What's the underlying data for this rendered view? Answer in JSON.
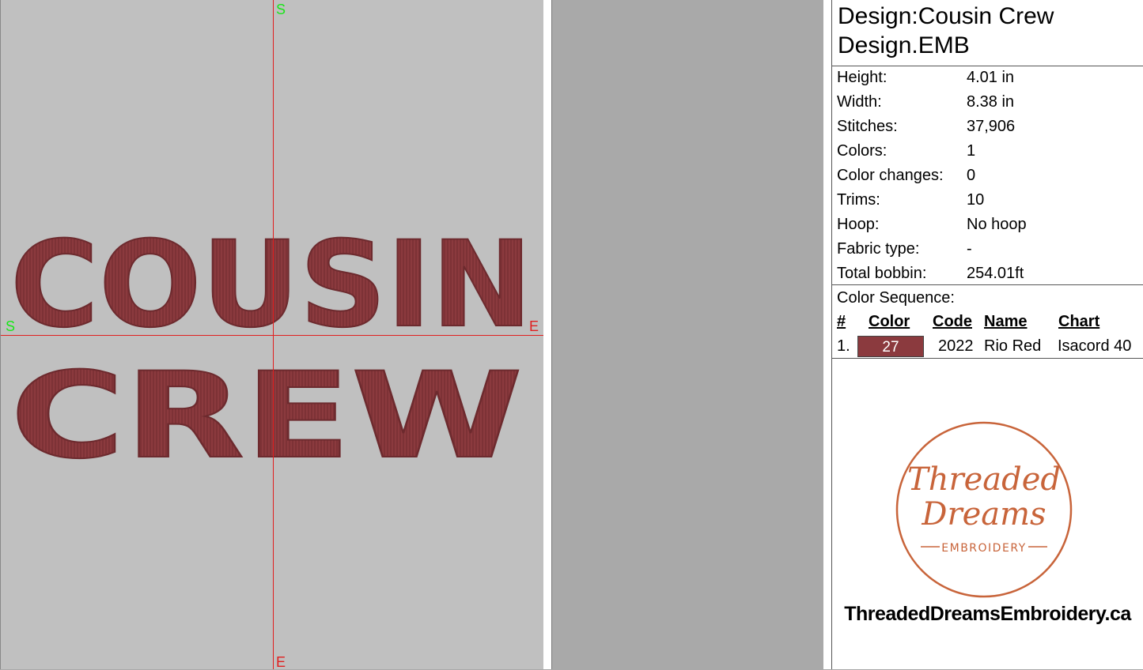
{
  "design": {
    "title": "Design:Cousin Crew",
    "filename": "Design.EMB",
    "word_top": "COUSIN",
    "word_bottom": "CREW",
    "stitch_color": "#8b3a3e"
  },
  "markers": {
    "start": "S",
    "end": "E"
  },
  "stats": [
    {
      "label": "Height:",
      "value": "4.01 in"
    },
    {
      "label": "Width:",
      "value": "8.38 in"
    },
    {
      "label": "Stitches:",
      "value": "37,906"
    },
    {
      "label": "Colors:",
      "value": "1"
    },
    {
      "label": "Color changes:",
      "value": "0"
    },
    {
      "label": "Trims:",
      "value": "10"
    },
    {
      "label": "Hoop:",
      "value": "No hoop"
    },
    {
      "label": "Fabric type:",
      "value": "-"
    },
    {
      "label": "Total bobbin:",
      "value": "254.01ft"
    }
  ],
  "color_sequence": {
    "title": "Color Sequence:",
    "headers": {
      "num": "#",
      "color": "Color",
      "code": "Code",
      "name": "Name",
      "chart": "Chart"
    },
    "rows": [
      {
        "num": "1.",
        "color_number": "27",
        "swatch": "#8b3a3e",
        "code": "2022",
        "name": "Rio Red",
        "chart": "Isacord 40"
      }
    ]
  },
  "logo": {
    "line1": "Threaded",
    "line2": "Dreams",
    "line3": "EMBROIDERY",
    "accent": "#c8643a"
  },
  "website": "ThreadedDreamsEmbroidery.ca",
  "colors": {
    "canvas_bg": "#c0c0c0",
    "guide_line": "#e02020",
    "marker_green": "#19e619"
  }
}
